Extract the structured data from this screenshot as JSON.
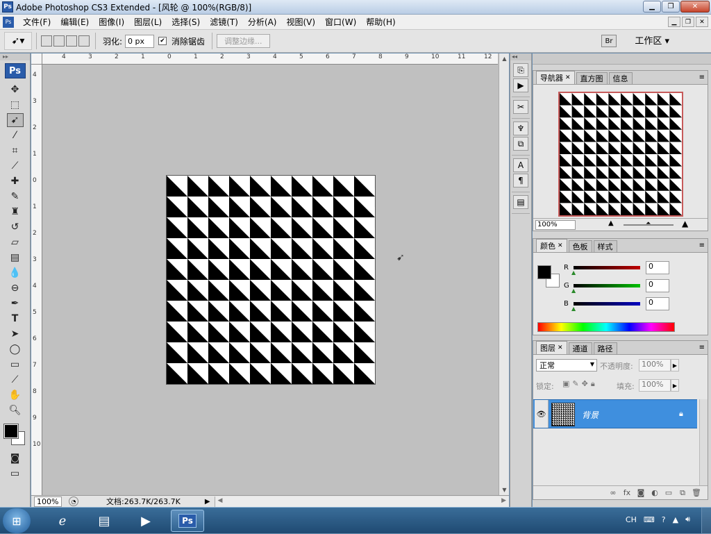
{
  "window": {
    "title": "Adobe Photoshop CS3 Extended - [风轮 @ 100%(RGB/8)]",
    "app_icon": "Ps",
    "buttons": [
      "minimize-icon",
      "restore-icon",
      "close-icon"
    ]
  },
  "menubar": {
    "items": [
      "文件(F)",
      "编辑(E)",
      "图像(I)",
      "图层(L)",
      "选择(S)",
      "滤镜(T)",
      "分析(A)",
      "视图(V)",
      "窗口(W)",
      "帮助(H)"
    ]
  },
  "options": {
    "feather_label": "羽化:",
    "feather_value": "0 px",
    "antialias_label": "消除锯齿",
    "antialias_checked": true,
    "refine_edge": "调整边缘...",
    "workspace": "工作区 ▾"
  },
  "toolbox": {
    "logo": "Ps",
    "tools": [
      "move-tool-icon",
      "marquee-tool-icon",
      "lasso-tool-icon",
      "magic-wand-icon",
      "crop-tool-icon",
      "slice-tool-icon",
      "healing-brush-icon",
      "brush-tool-icon",
      "clone-stamp-icon",
      "history-brush-icon",
      "eraser-tool-icon",
      "gradient-tool-icon",
      "blur-tool-icon",
      "dodge-tool-icon",
      "pen-tool-icon",
      "type-tool-icon",
      "path-select-icon",
      "ellipse-tool-icon",
      "notes-tool-icon",
      "eyedropper-icon",
      "hand-tool-icon",
      "zoom-tool-icon"
    ],
    "active_tool": "lasso-tool-icon",
    "foreground_color": "#000000",
    "background_color": "#ffffff"
  },
  "rulers": {
    "top_labels": [
      "4",
      "3",
      "2",
      "1",
      "0",
      "1",
      "2",
      "3",
      "4",
      "5",
      "6",
      "7",
      "8",
      "9",
      "10",
      "11",
      "12"
    ],
    "left_labels": [
      "4",
      "3",
      "2",
      "1",
      "0",
      "1",
      "2",
      "3",
      "4",
      "5",
      "6",
      "7",
      "8",
      "9",
      "10"
    ]
  },
  "document": {
    "name": "风轮",
    "pattern": "triangle-checker",
    "grid": 10,
    "colors": [
      "#000000",
      "#ffffff"
    ]
  },
  "status": {
    "zoom": "100%",
    "doc_info": "文档:263.7K/263.7K"
  },
  "navigator": {
    "tabs": [
      "导航器",
      "直方图",
      "信息"
    ],
    "zoom": "100%",
    "frame_color": "#c75a5a"
  },
  "color_panel": {
    "tabs": [
      "颜色",
      "色板",
      "样式"
    ],
    "channels": [
      {
        "name": "R",
        "value": "0",
        "color": "#c00000"
      },
      {
        "name": "G",
        "value": "0",
        "color": "#00a000"
      },
      {
        "name": "B",
        "value": "0",
        "color": "#0000c0"
      }
    ]
  },
  "layers_panel": {
    "tabs": [
      "图层",
      "通道",
      "路径"
    ],
    "blend_mode": "正常",
    "opacity_label": "不透明度:",
    "opacity_value": "100%",
    "lock_label": "锁定:",
    "fill_label": "填充:",
    "fill_value": "100%",
    "layers": [
      {
        "name": "背景",
        "selected": true,
        "locked": true
      }
    ],
    "selection_color": "#3f8fde"
  },
  "taskbar": {
    "apps": [
      "ie-icon",
      "explorer-icon",
      "media-player-icon",
      "photoshop-icon"
    ],
    "active_app": "Ps",
    "tray_lang": "CH"
  }
}
